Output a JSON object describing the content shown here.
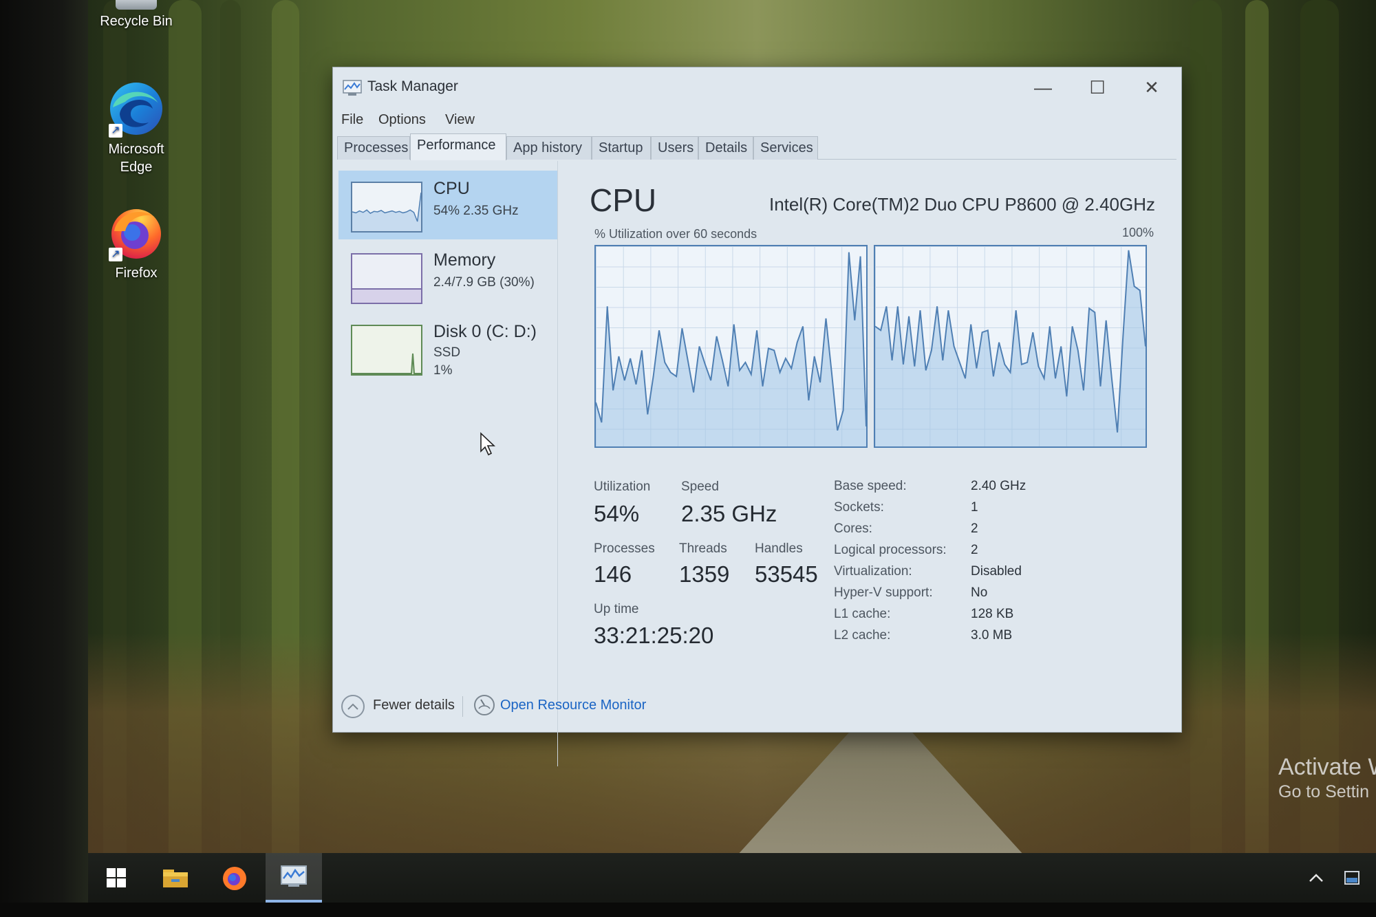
{
  "desktop": {
    "icons": [
      {
        "label": "Recycle Bin",
        "icon": "recycle-bin-icon"
      },
      {
        "label": "Microsoft Edge",
        "icon": "edge-icon"
      },
      {
        "label": "Firefox",
        "icon": "firefox-icon"
      }
    ],
    "watermark": {
      "line1": "Activate W",
      "line2": "Go to Settin"
    }
  },
  "taskbar": {
    "items": [
      "start-icon",
      "file-explorer-icon",
      "firefox-icon",
      "task-manager-icon"
    ],
    "active": "task-manager-icon",
    "tray": [
      "chevron-up-icon",
      "notification-icon"
    ]
  },
  "window": {
    "title": "Task Manager",
    "controls": {
      "minimize": "—",
      "maximize": "☐",
      "close": "✕"
    },
    "menu": [
      "File",
      "Options",
      "View"
    ],
    "tabs": [
      "Processes",
      "Performance",
      "App history",
      "Startup",
      "Users",
      "Details",
      "Services"
    ],
    "active_tab": "Performance"
  },
  "sidebar": {
    "items": [
      {
        "title": "CPU",
        "sub1": "54%  2.35 GHz",
        "selected": true
      },
      {
        "title": "Memory",
        "sub1": "2.4/7.9 GB (30%)",
        "selected": false
      },
      {
        "title": "Disk 0 (C: D:)",
        "sub1": "SSD",
        "sub2": "1%",
        "selected": false
      }
    ]
  },
  "cpu": {
    "heading": "CPU",
    "model": "Intel(R) Core(TM)2 Duo CPU P8600 @ 2.40GHz",
    "graph_caption": "% Utilization over 60 seconds",
    "graph_max": "100%",
    "stats": {
      "utilization_label": "Utilization",
      "utilization": "54%",
      "speed_label": "Speed",
      "speed": "2.35 GHz",
      "processes_label": "Processes",
      "processes": "146",
      "threads_label": "Threads",
      "threads": "1359",
      "handles_label": "Handles",
      "handles": "53545",
      "uptime_label": "Up time",
      "uptime": "33:21:25:20"
    },
    "specs": [
      {
        "key": "Base speed:",
        "value": "2.40 GHz"
      },
      {
        "key": "Sockets:",
        "value": "1"
      },
      {
        "key": "Cores:",
        "value": "2"
      },
      {
        "key": "Logical processors:",
        "value": "2"
      },
      {
        "key": "Virtualization:",
        "value": "Disabled"
      },
      {
        "key": "Hyper-V support:",
        "value": "No"
      },
      {
        "key": "L1 cache:",
        "value": "128 KB"
      },
      {
        "key": "L2 cache:",
        "value": "3.0 MB"
      }
    ],
    "core_graphs": [
      [
        22,
        12,
        70,
        28,
        45,
        33,
        44,
        31,
        48,
        16,
        35,
        58,
        42,
        37,
        35,
        59,
        43,
        27,
        50,
        41,
        33,
        55,
        43,
        30,
        61,
        38,
        42,
        36,
        58,
        30,
        49,
        48,
        37,
        44,
        39,
        52,
        60,
        23,
        45,
        32,
        64,
        37,
        8,
        18,
        97,
        63,
        95,
        10
      ],
      [
        60,
        58,
        70,
        43,
        70,
        41,
        65,
        40,
        68,
        38,
        48,
        70,
        43,
        68,
        50,
        42,
        34,
        61,
        39,
        57,
        58,
        35,
        52,
        41,
        37,
        68,
        41,
        42,
        57,
        40,
        34,
        60,
        34,
        50,
        25,
        60,
        48,
        28,
        69,
        67,
        30,
        63,
        34,
        7,
        55,
        98,
        80,
        78,
        50
      ]
    ],
    "sidebar_cpu_spark": [
      40,
      38,
      42,
      39,
      44,
      37,
      41,
      40,
      43,
      38,
      40,
      42,
      39,
      41,
      38,
      40,
      44,
      39,
      20,
      80
    ]
  },
  "footer": {
    "fewer_details": "Fewer details",
    "open_resource_monitor": "Open Resource Monitor"
  },
  "colors": {
    "accent": "#4f7fb3",
    "graph_fill": "#c7dcef",
    "link": "#1a64c4",
    "selected": "#b4d4f0"
  }
}
